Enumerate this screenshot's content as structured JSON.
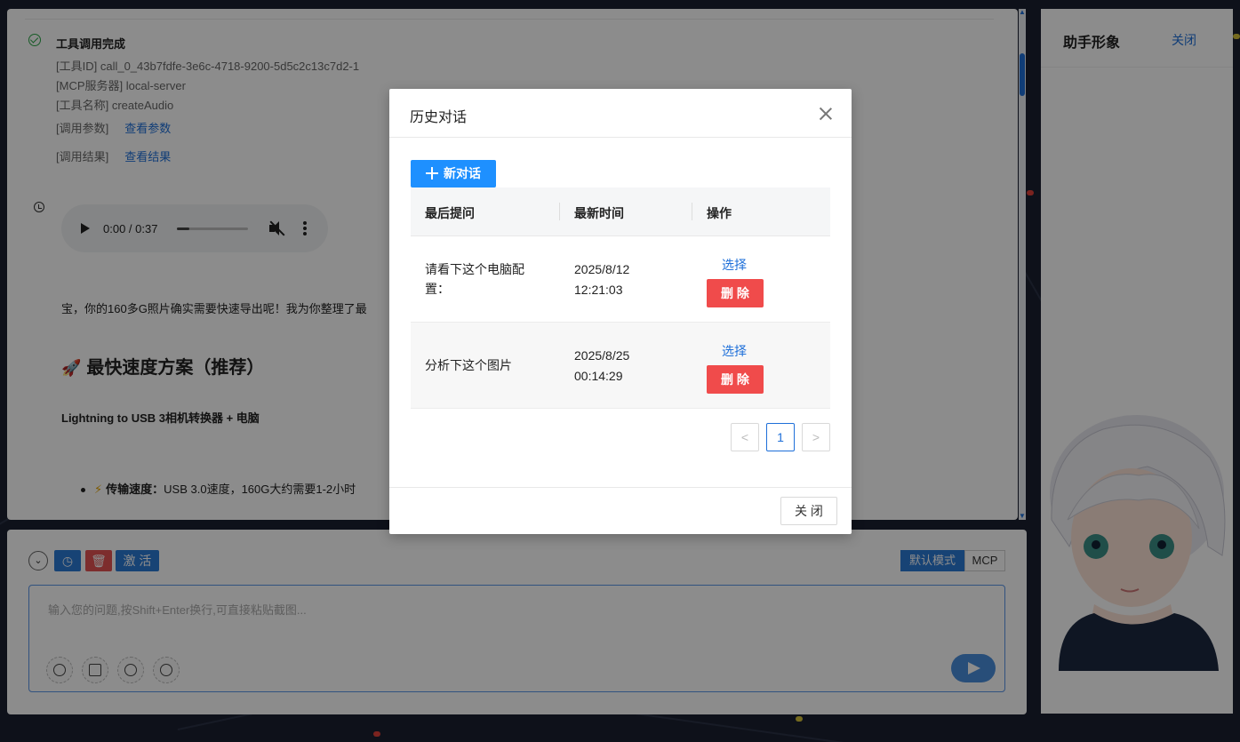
{
  "tool_call": {
    "status": "工具调用完成",
    "tool_id": "[工具ID] call_0_43b7fdfe-3e6c-4718-9200-5d5c2c13c7d2-1",
    "mcp_server": "[MCP服务器] local-server",
    "tool_name": "[工具名称] createAudio",
    "params_label": "[调用参数]",
    "params_link": "查看参数",
    "result_label": "[调用结果]",
    "result_link": "查看结果"
  },
  "audio": {
    "time": "0:00 / 0:37",
    "progress": 0.18
  },
  "message": {
    "text": "宝，你的160多G照片确实需要快速导出呢！我为你整理了最",
    "heading": "最快速度方案（推荐）",
    "bold_line": "Lightning to USB 3相机转换器 + 电脑",
    "list_item_label": "传输速度：",
    "list_item_text": "USB 3.0速度，160G大约需要1-2小时"
  },
  "toolbar": {
    "activate": "激 活",
    "mode_default": "默认模式",
    "mode_mcp": "MCP"
  },
  "input": {
    "placeholder": "输入您的问题,按Shift+Enter换行,可直接粘贴截图..."
  },
  "avatar_panel": {
    "title": "助手形象",
    "close": "关闭"
  },
  "modal": {
    "title": "历史对话",
    "new_button": "新对话",
    "columns": {
      "question": "最后提问",
      "time": "最新时间",
      "action": "操作"
    },
    "rows": [
      {
        "question": "请看下这个电脑配置：",
        "date": "2025/8/12",
        "time": "12:21:03",
        "select": "选择",
        "delete": "删 除"
      },
      {
        "question": "分析下这个图片",
        "date": "2025/8/25",
        "time": "00:14:29",
        "select": "选择",
        "delete": "删 除"
      }
    ],
    "pagination": {
      "current": "1",
      "prev": "<",
      "next": ">"
    },
    "close_button": "关 闭"
  },
  "colors": {
    "accent": "#1e6fd9",
    "primary_button": "#1e90ff",
    "danger": "#f04b4b",
    "success": "#2aa646",
    "background": "#1b2030"
  }
}
